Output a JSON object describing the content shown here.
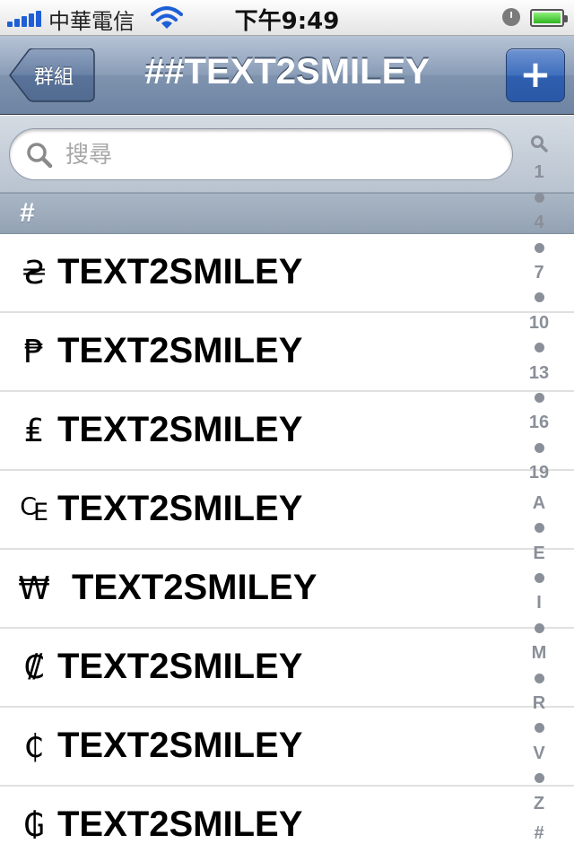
{
  "status_bar": {
    "carrier": "中華電信",
    "time": "下午9:49",
    "signal_icon": "signal-bars-icon",
    "wifi_icon": "wifi-icon",
    "clock_icon": "alarm-clock-icon",
    "battery_icon": "battery-icon",
    "battery_level": 1.0
  },
  "nav": {
    "back_label": "群組",
    "title": "##TEXT2SMILEY",
    "add_label": "+"
  },
  "search": {
    "placeholder": "搜尋",
    "value": ""
  },
  "section": {
    "header": "#"
  },
  "rows": [
    {
      "symbol": "₴",
      "label": "TEXT2SMILEY"
    },
    {
      "symbol": "₱",
      "label": "TEXT2SMILEY"
    },
    {
      "symbol": "₤",
      "label": "TEXT2SMILEY"
    },
    {
      "symbol": "₠",
      "label": "TEXT2SMILEY"
    },
    {
      "symbol": "₩",
      "label": "TEXT2SMILEY"
    },
    {
      "symbol": "₡",
      "label": "TEXT2SMILEY"
    },
    {
      "symbol": "₵",
      "label": "TEXT2SMILEY"
    },
    {
      "symbol": "₲",
      "label": "TEXT2SMILEY"
    }
  ],
  "index_labels": [
    "1",
    "4",
    "7",
    "10",
    "13",
    "16",
    "19",
    "A",
    "E",
    "I",
    "M",
    "R",
    "V",
    "Z",
    "#"
  ],
  "colors": {
    "nav_blue": "#7f93ae",
    "add_button_blue": "#3f6fbd",
    "index_gray": "#8a8f99"
  }
}
